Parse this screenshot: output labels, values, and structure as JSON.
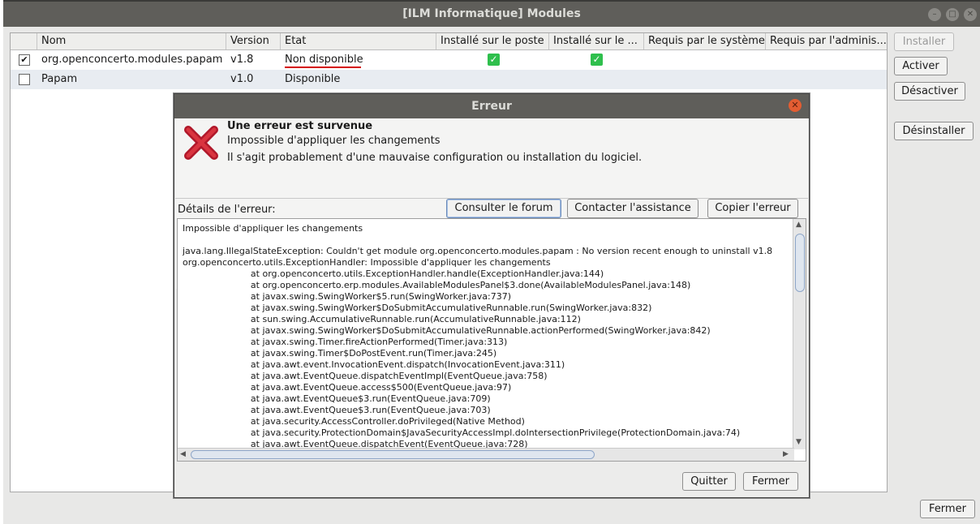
{
  "window": {
    "title": "[ILM Informatique] Modules",
    "fermer_label": "Fermer"
  },
  "table": {
    "headers": [
      "Nom",
      "Version",
      "Etat",
      "Installé sur le poste",
      "Installé sur le ...",
      "Requis par le système",
      "Requis par l'adminis..."
    ],
    "rows": [
      {
        "checked": true,
        "name": "org.openconcerto.modules.papam",
        "version": "v1.8",
        "state": "Non disponible",
        "installed_local": true,
        "installed_other": true
      },
      {
        "checked": false,
        "name": "Papam",
        "version": "v1.0",
        "state": "Disponible",
        "installed_local": false,
        "installed_other": false
      }
    ]
  },
  "side_buttons": {
    "installer": "Installer",
    "activer": "Activer",
    "desactiver": "Désactiver",
    "desinstaller": "Désinstaller"
  },
  "dialog": {
    "title": "Erreur",
    "heading": "Une erreur est survenue",
    "message1": "Impossible d'appliquer les changements",
    "message2": "Il s'agit probablement d'une mauvaise configuration ou installation du logiciel.",
    "btn_forum": "Consulter le forum",
    "btn_assist": "Contacter l'assistance",
    "btn_copy": "Copier l'erreur",
    "details_label": "Détails de l'erreur:",
    "trace": "Impossible d'appliquer les changements\n\njava.lang.IllegalStateException: Couldn't get module org.openconcerto.modules.papam : No version recent enough to uninstall v1.8\norg.openconcerto.utils.ExceptionHandler: Impossible d'appliquer les changements\n\t\t\tat org.openconcerto.utils.ExceptionHandler.handle(ExceptionHandler.java:144)\n\t\t\tat org.openconcerto.erp.modules.AvailableModulesPanel$3.done(AvailableModulesPanel.java:148)\n\t\t\tat javax.swing.SwingWorker$5.run(SwingWorker.java:737)\n\t\t\tat javax.swing.SwingWorker$DoSubmitAccumulativeRunnable.run(SwingWorker.java:832)\n\t\t\tat sun.swing.AccumulativeRunnable.run(AccumulativeRunnable.java:112)\n\t\t\tat javax.swing.SwingWorker$DoSubmitAccumulativeRunnable.actionPerformed(SwingWorker.java:842)\n\t\t\tat javax.swing.Timer.fireActionPerformed(Timer.java:313)\n\t\t\tat javax.swing.Timer$DoPostEvent.run(Timer.java:245)\n\t\t\tat java.awt.event.InvocationEvent.dispatch(InvocationEvent.java:311)\n\t\t\tat java.awt.EventQueue.dispatchEventImpl(EventQueue.java:758)\n\t\t\tat java.awt.EventQueue.access$500(EventQueue.java:97)\n\t\t\tat java.awt.EventQueue$3.run(EventQueue.java:709)\n\t\t\tat java.awt.EventQueue$3.run(EventQueue.java:703)\n\t\t\tat java.security.AccessController.doPrivileged(Native Method)\n\t\t\tat java.security.ProtectionDomain$JavaSecurityAccessImpl.doIntersectionPrivilege(ProtectionDomain.java:74)\n\t\t\tat java.awt.EventQueue.dispatchEvent(EventQueue.java:728)",
    "btn_quit": "Quitter",
    "btn_close": "Fermer"
  },
  "colors": {
    "titlebar": "#5f5e5a",
    "error_red": "#d40000",
    "check_green": "#2fbf4d",
    "close_orange": "#e35d32"
  },
  "icons": {
    "error": "error-x-icon",
    "check": "check-icon",
    "close": "close-icon"
  }
}
